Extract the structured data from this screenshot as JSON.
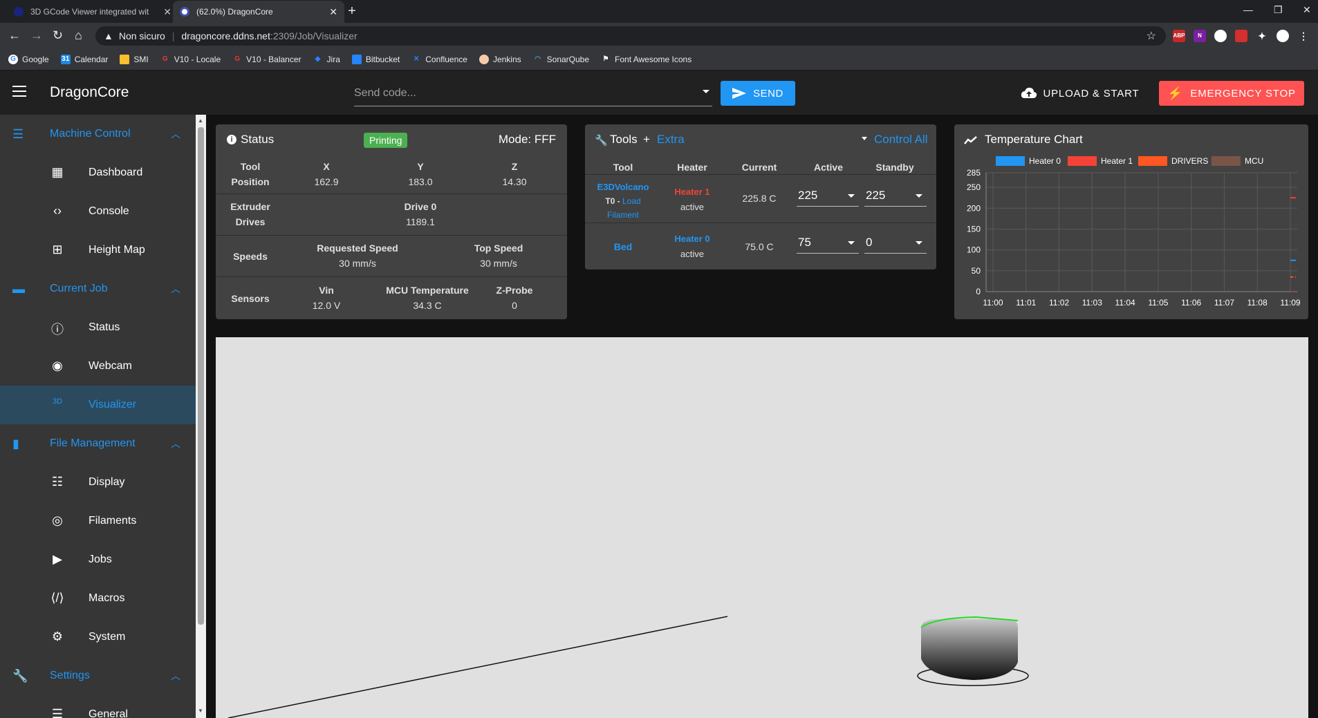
{
  "browser": {
    "tabs": [
      {
        "title": "3D GCode Viewer integrated wit",
        "close": "✕"
      },
      {
        "title": "(62.0%) DragonCore",
        "close": "✕"
      }
    ],
    "new_tab": "+",
    "address": {
      "security": "Non sicuro",
      "host": "dragoncore.ddns.net",
      "path": ":2309/Job/Visualizer"
    },
    "bookmarks": [
      "Google",
      "Calendar",
      "SMI",
      "V10 - Locale",
      "V10 - Balancer",
      "Jira",
      "Bitbucket",
      "Confluence",
      "Jenkins",
      "SonarQube",
      "Font Awesome Icons"
    ],
    "extensions": [
      "ABP",
      "N"
    ]
  },
  "header": {
    "brand": "DragonCore",
    "send_placeholder": "Send code...",
    "send_label": "SEND",
    "upload_label": "UPLOAD & START",
    "estop_label": "EMERGENCY STOP"
  },
  "sidebar": {
    "groups": [
      {
        "label": "Machine Control",
        "items": [
          "Dashboard",
          "Console",
          "Height Map"
        ]
      },
      {
        "label": "Current Job",
        "items": [
          "Status",
          "Webcam",
          "Visualizer"
        ]
      },
      {
        "label": "File Management",
        "items": [
          "Display",
          "Filaments",
          "Jobs",
          "Macros",
          "System"
        ]
      },
      {
        "label": "Settings",
        "items": [
          "General"
        ]
      }
    ],
    "active_item": "Visualizer"
  },
  "status": {
    "title": "Status",
    "badge": "Printing",
    "mode": "Mode: FFF",
    "tool_position": {
      "label1": "Tool",
      "label2": "Position",
      "x_h": "X",
      "x": "162.9",
      "y_h": "Y",
      "y": "183.0",
      "z_h": "Z",
      "z": "14.30"
    },
    "extruder": {
      "label1": "Extruder",
      "label2": "Drives",
      "h": "Drive 0",
      "v": "1189.1"
    },
    "speeds": {
      "label": "Speeds",
      "req_h": "Requested Speed",
      "req": "30 mm/s",
      "top_h": "Top Speed",
      "top": "30 mm/s"
    },
    "sensors": {
      "label": "Sensors",
      "vin_h": "Vin",
      "vin": "12.0 V",
      "mcu_h": "MCU Temperature",
      "mcu": "34.3 C",
      "zp_h": "Z-Probe",
      "zp": "0"
    }
  },
  "tools": {
    "title": "Tools",
    "extra": "Extra",
    "control_all": "Control All",
    "headers": [
      "Tool",
      "Heater",
      "Current",
      "Active",
      "Standby"
    ],
    "rows": [
      {
        "tool": "E3DVolcano",
        "sub1": "T0 - ",
        "sub2": "Load",
        "sub3": "Filament",
        "heater": "Heater 1",
        "state": "active",
        "current": "225.8 C",
        "active": "225",
        "standby": "225"
      },
      {
        "tool": "Bed",
        "heater": "Heater 0",
        "state": "active",
        "current": "75.0 C",
        "active": "75",
        "standby": "0"
      }
    ]
  },
  "temp_chart": {
    "title": "Temperature Chart",
    "colors": {
      "heater0": "#2196f3",
      "heater1": "#f44336",
      "drivers": "#ff5722",
      "mcu": "#795548"
    }
  },
  "chart_data": {
    "type": "line",
    "legend": [
      "Heater 0",
      "Heater 1",
      "DRIVERS",
      "MCU"
    ],
    "x_ticks": [
      "11:00",
      "11:01",
      "11:02",
      "11:03",
      "11:04",
      "11:05",
      "11:06",
      "11:07",
      "11:08",
      "11:09"
    ],
    "y_ticks": [
      "285",
      "250",
      "200",
      "150",
      "100",
      "50",
      "0"
    ],
    "ylim": [
      0,
      285
    ],
    "series": [
      {
        "name": "Heater 0",
        "x": [
          "11:09"
        ],
        "values": [
          75
        ]
      },
      {
        "name": "Heater 1",
        "x": [
          "11:09"
        ],
        "values": [
          225
        ]
      },
      {
        "name": "DRIVERS",
        "x": [
          "11:09"
        ],
        "values": [
          35
        ]
      },
      {
        "name": "MCU",
        "x": [
          "11:09"
        ],
        "values": [
          0
        ]
      }
    ]
  }
}
